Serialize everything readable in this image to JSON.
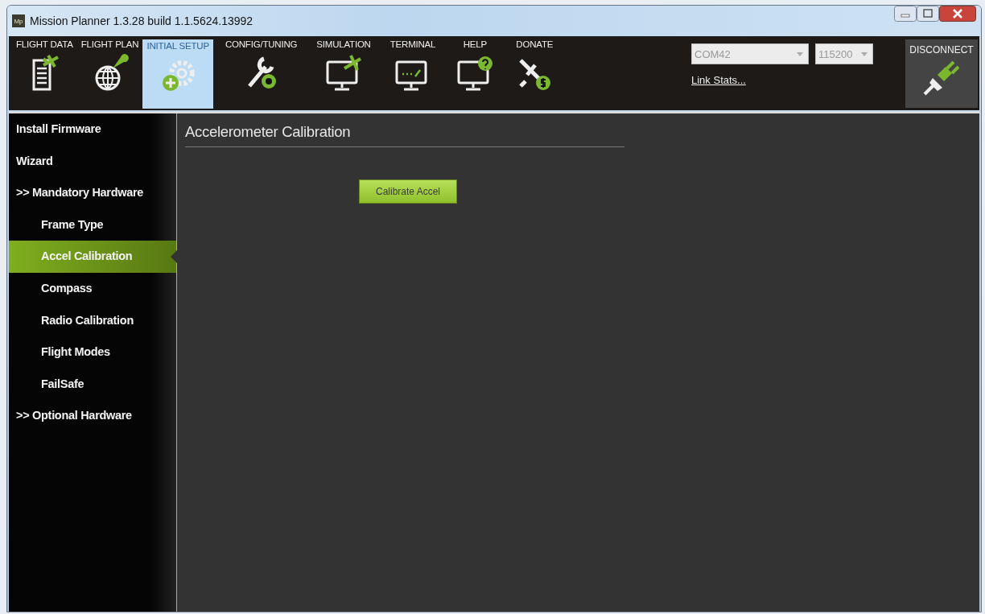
{
  "window": {
    "title": "Mission Planner 1.3.28 build 1.1.5624.13992",
    "app_badge": "Mp"
  },
  "tabs": [
    {
      "label": "FLIGHT DATA",
      "kind": "data",
      "selected": false
    },
    {
      "label": "FLIGHT PLAN",
      "kind": "plan",
      "selected": false
    },
    {
      "label": "INITIAL SETUP",
      "kind": "setup",
      "selected": true
    },
    {
      "label": "CONFIG/TUNING",
      "kind": "tuning",
      "selected": false
    },
    {
      "label": "SIMULATION",
      "kind": "simulation",
      "selected": false
    },
    {
      "label": "TERMINAL",
      "kind": "terminal",
      "selected": false
    },
    {
      "label": "HELP",
      "kind": "help",
      "selected": false
    },
    {
      "label": "DONATE",
      "kind": "donate",
      "selected": false
    }
  ],
  "connection": {
    "port": "COM42",
    "baud": "115200",
    "link_stats": "Link Stats...",
    "disconnect": "DISCONNECT"
  },
  "sidebar": {
    "items": [
      {
        "label": "Install Firmware",
        "selected": false
      },
      {
        "label": "Wizard",
        "selected": false
      },
      {
        "label": ">> Mandatory Hardware",
        "selected": false,
        "children": [
          {
            "label": "Frame Type",
            "selected": false
          },
          {
            "label": "Accel Calibration",
            "selected": true
          },
          {
            "label": "Compass",
            "selected": false
          },
          {
            "label": "Radio Calibration",
            "selected": false
          },
          {
            "label": "Flight Modes",
            "selected": false
          },
          {
            "label": "FailSafe",
            "selected": false
          }
        ]
      },
      {
        "label": ">> Optional Hardware",
        "selected": false
      }
    ]
  },
  "content": {
    "title": "Accelerometer Calibration",
    "button": "Calibrate Accel"
  }
}
